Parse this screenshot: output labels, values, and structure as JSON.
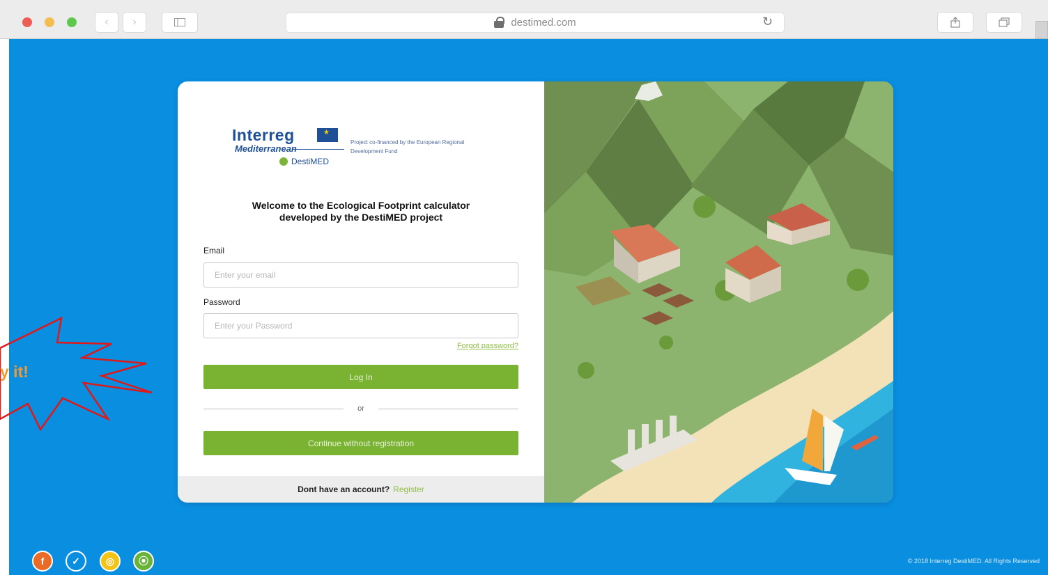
{
  "browser": {
    "url": "destimed.com",
    "traffic_lights": [
      "#ee5c56",
      "#f4bd4f",
      "#5dc94c"
    ],
    "icons": [
      "back-icon",
      "forward-icon",
      "sidebar-icon",
      "lock-icon",
      "reload-icon",
      "share-icon",
      "tabs-icon"
    ]
  },
  "logo": {
    "interreg": "Interreg",
    "mediterranean": "Mediterranean",
    "destimed": "DestiMED",
    "caption": "Project co-financed by the European Regional Development Fund"
  },
  "welcome": {
    "line1": "Welcome to the Ecological Footprint calculator",
    "line2": "developed by the DestiMED project"
  },
  "form": {
    "email_label": "Email",
    "email_placeholder": "Enter your email",
    "password_label": "Password",
    "password_placeholder": "Enter your Password",
    "forgot": "Forgot password?",
    "login": "Log In",
    "or": "or",
    "continue": "Continue without registration"
  },
  "footer": {
    "no_account": "Dont have an account?",
    "register": "Register"
  },
  "social": [
    {
      "icon": "facebook-icon",
      "glyph": "f",
      "color": "#e96b26"
    },
    {
      "icon": "twitter-icon",
      "glyph": "✓",
      "color": "#0a8ee0"
    },
    {
      "icon": "instagram-icon",
      "glyph": "◎",
      "color": "#f3c316"
    },
    {
      "icon": "rss-icon",
      "glyph": "⦿",
      "color": "#68b338"
    }
  ],
  "copyright": "© 2018 Interreg DestiMED. All Rights Reserved",
  "callout": "y it!",
  "colors": {
    "background": "#0a8ee0",
    "primary_button": "#7ab232",
    "link": "#8fbf45",
    "callout_stroke": "#e01818",
    "callout_text": "#f19a34"
  }
}
